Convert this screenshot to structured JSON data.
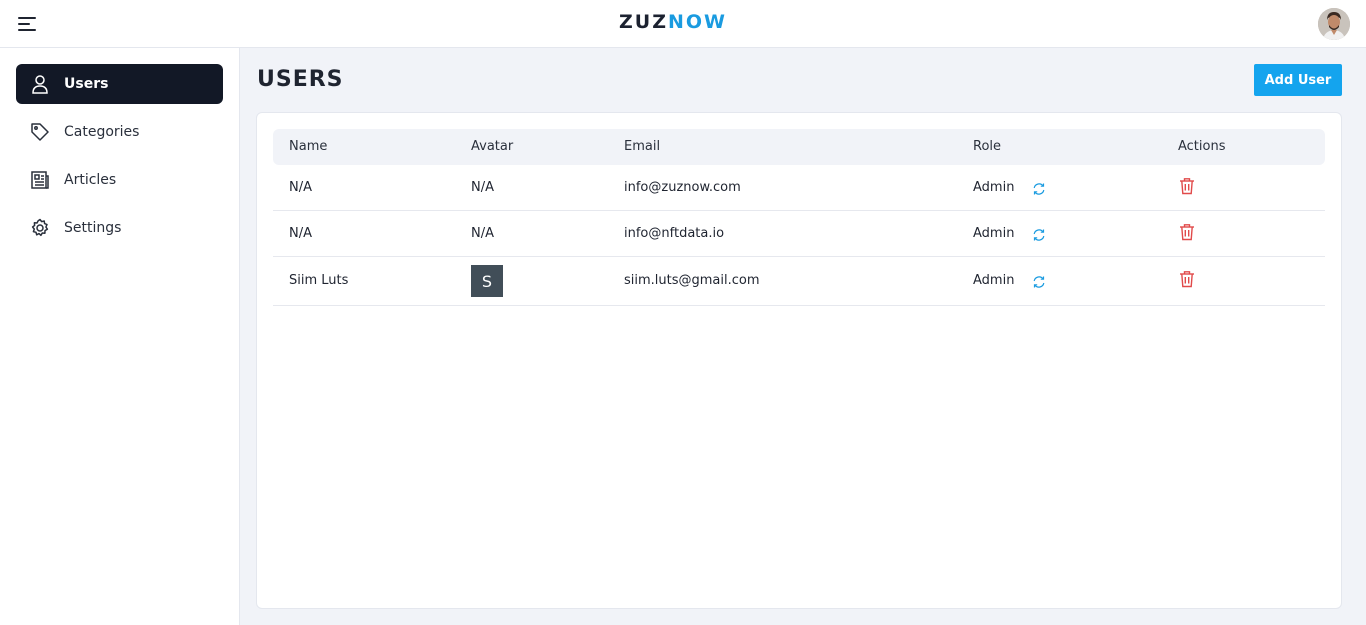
{
  "header": {
    "logo_part1": "ZUZ",
    "logo_part2": "NOW"
  },
  "sidebar": {
    "items": [
      {
        "label": "Users",
        "icon": "user-icon",
        "active": true
      },
      {
        "label": "Categories",
        "icon": "tag-icon",
        "active": false
      },
      {
        "label": "Articles",
        "icon": "newspaper-icon",
        "active": false
      },
      {
        "label": "Settings",
        "icon": "gear-icon",
        "active": false
      }
    ]
  },
  "main": {
    "title": "USERS",
    "add_button_label": "Add User",
    "table": {
      "columns": [
        "Name",
        "Avatar",
        "Email",
        "Role",
        "Actions"
      ],
      "rows": [
        {
          "name": "N/A",
          "avatar": "N/A",
          "email": "info@zuznow.com",
          "role": "Admin"
        },
        {
          "name": "N/A",
          "avatar": "N/A",
          "email": "info@nftdata.io",
          "role": "Admin"
        },
        {
          "name": "Siim Luts",
          "avatar": "S",
          "email": "siim.luts@gmail.com",
          "role": "Admin"
        }
      ]
    }
  },
  "colors": {
    "accent": "#14a4ee",
    "active_nav": "#121826",
    "delete": "#e14a4a",
    "refresh": "#1a9be0",
    "avatar_bg": "#414e58"
  }
}
